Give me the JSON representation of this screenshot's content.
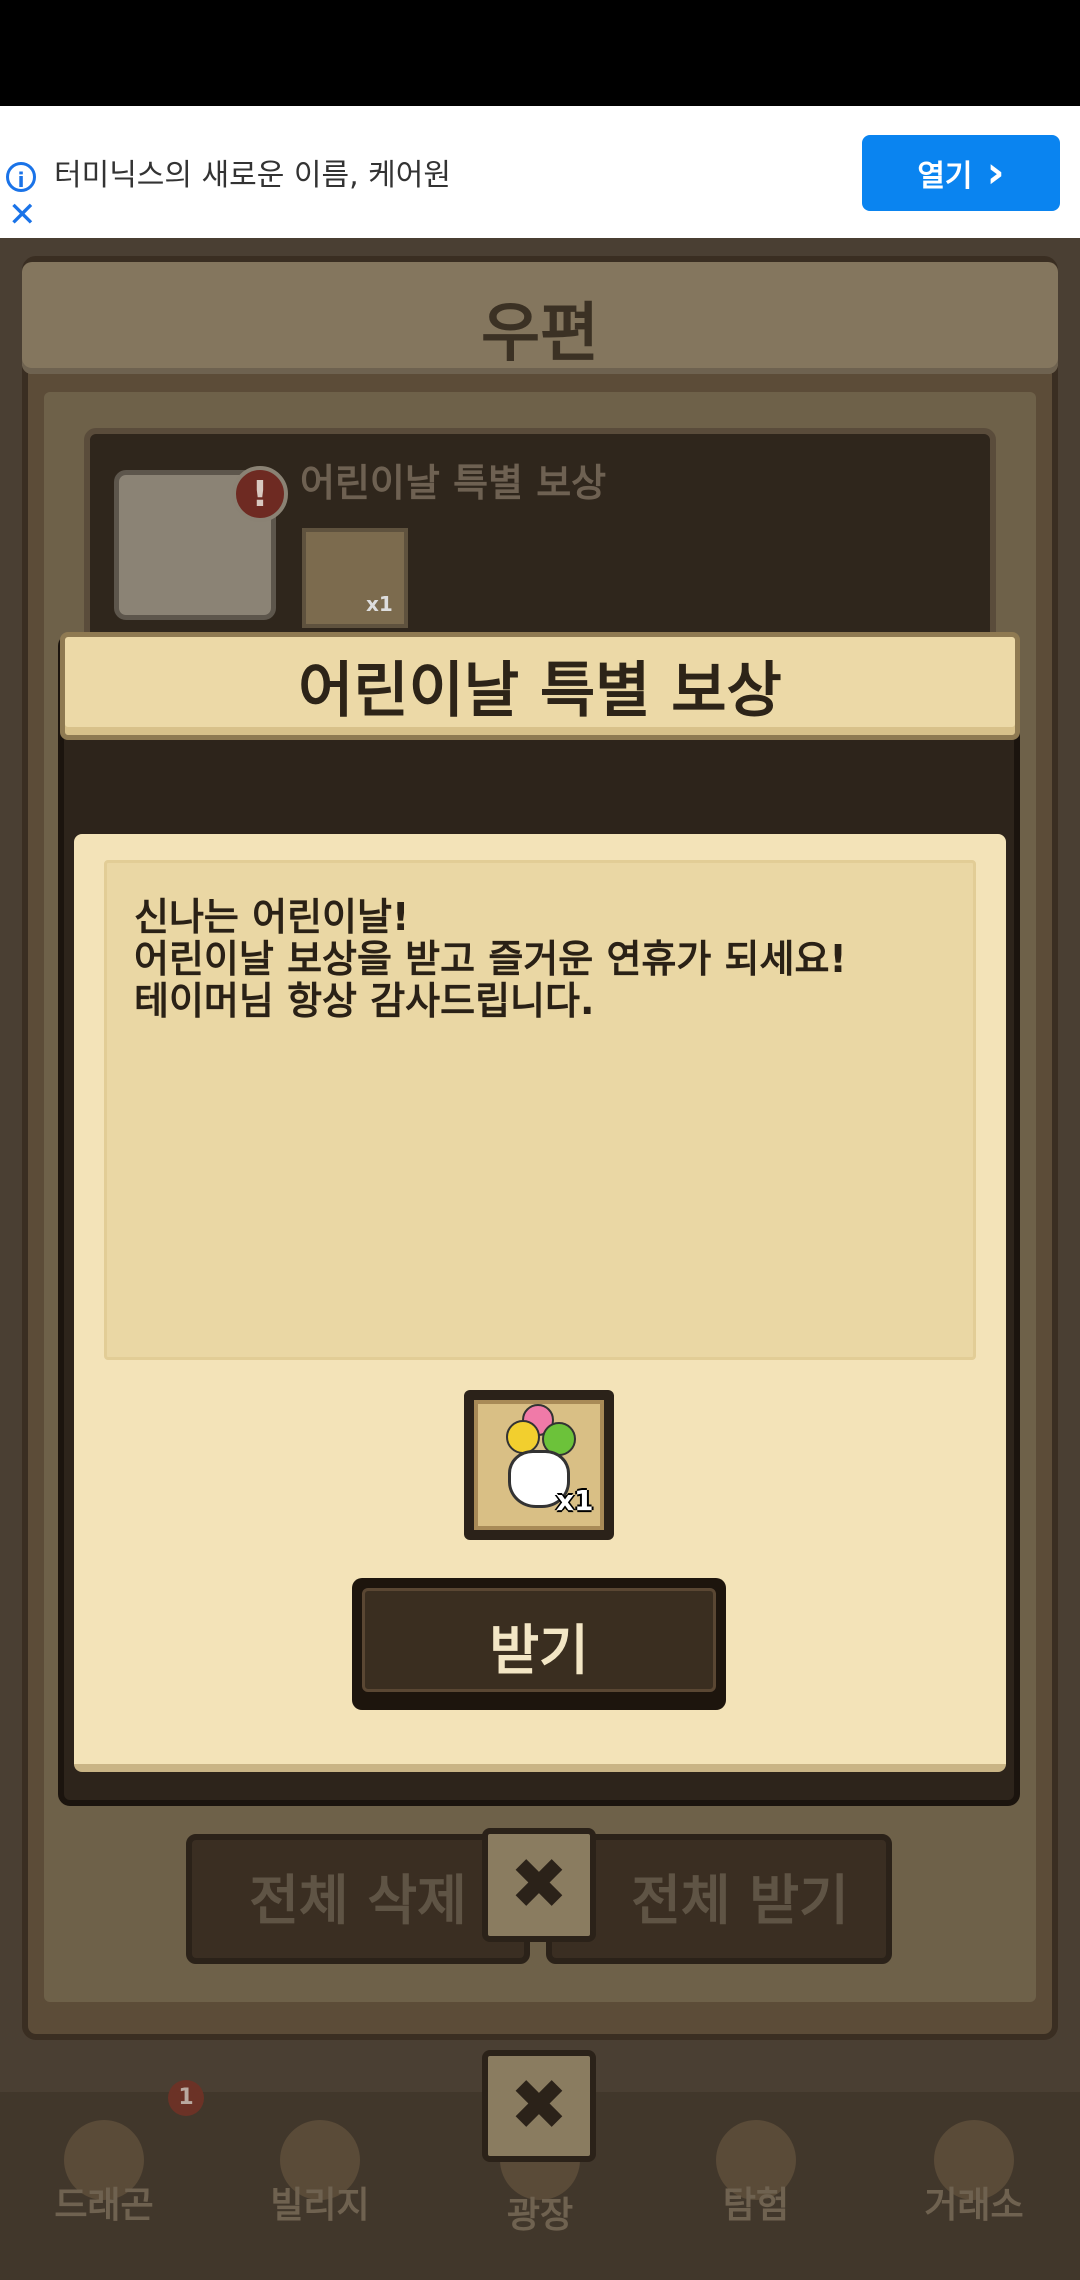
{
  "ad": {
    "info_icon": "info-icon",
    "text": "터미닉스의 새로운 이름, 케어원",
    "close_icon": "close-icon",
    "open_label": "열기",
    "open_chevron": "›"
  },
  "mail": {
    "title": "우편",
    "item_title": "어린이날 특별 보상",
    "item_alert": "!",
    "item_reward_qty": "x1",
    "delete_all": "전체 삭제",
    "receive_all": "전체 받기",
    "close_symbol": "✖"
  },
  "nav": {
    "items": [
      "드래곤",
      "빌리지",
      "광장",
      "탐험",
      "거래소"
    ],
    "badge": "1",
    "close_symbol": "✖"
  },
  "popup": {
    "title": "어린이날 특별 보상",
    "message": [
      "신나는 어린이날!",
      "어린이날 보상을 받고 즐거운 연휴가 되세요!",
      "테이머님 항상 감사드립니다."
    ],
    "reward_qty": "x1",
    "receive_label": "받기"
  }
}
